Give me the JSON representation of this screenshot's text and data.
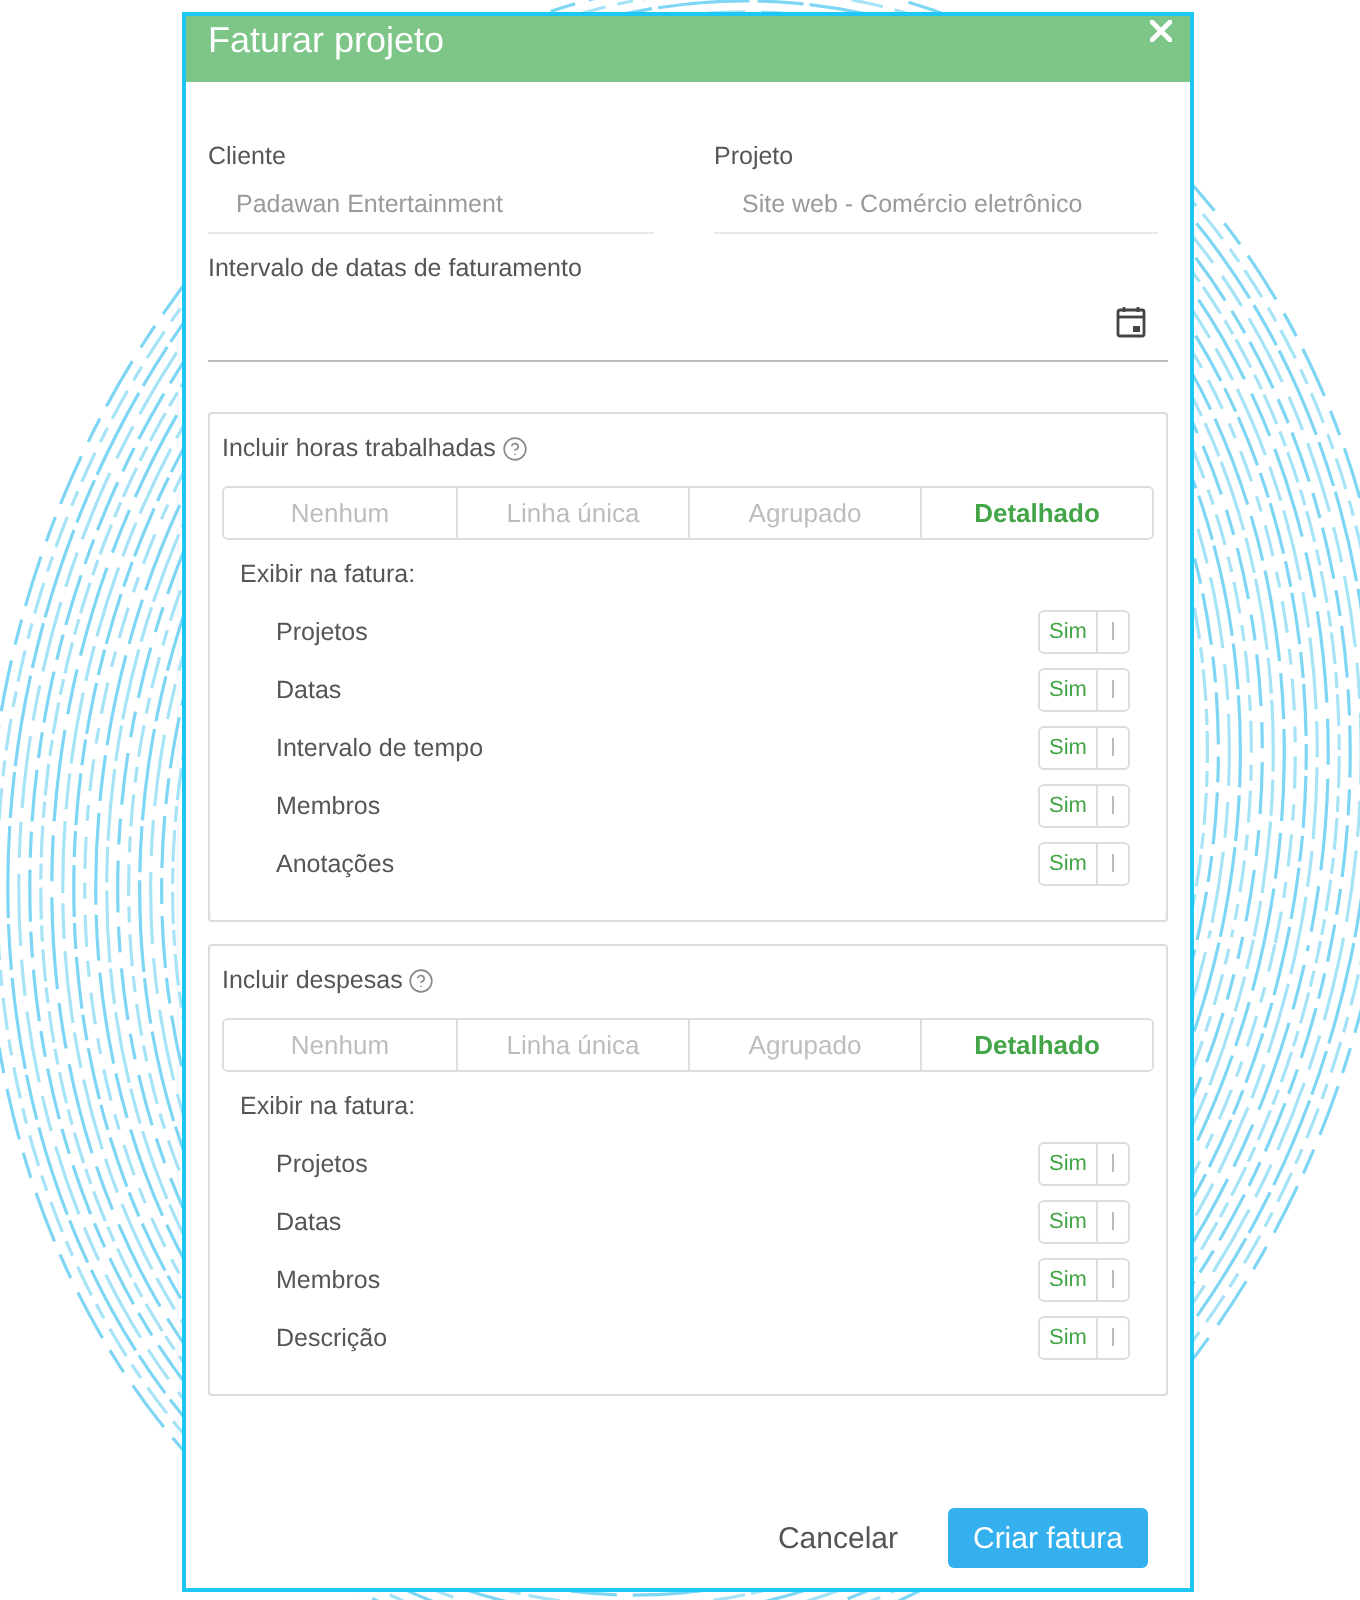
{
  "dialog": {
    "title": "Faturar projeto"
  },
  "fields": [
    {
      "label": "Cliente",
      "value": "Padawan Entertainment",
      "disabled": true
    },
    {
      "label": "Projeto",
      "value": "Site web - Comércio eletrônico",
      "disabled": true
    }
  ],
  "date_range": {
    "label": "Intervalo de datas de faturamento"
  },
  "sections": [
    {
      "title": "Incluir horas trabalhadas",
      "options": [
        {
          "label": "Nenhum",
          "selected": false
        },
        {
          "label": "Linha única",
          "selected": false
        },
        {
          "label": "Agrupado",
          "selected": false
        },
        {
          "label": "Detalhado",
          "selected": true
        }
      ],
      "show_label": "Exibir na fatura:",
      "toggles": [
        {
          "label": "Projetos",
          "switch_label": "Sim",
          "on": true
        },
        {
          "label": "Datas",
          "switch_label": "Sim",
          "on": true
        },
        {
          "label": "Intervalo de tempo",
          "switch_label": "Sim",
          "on": true
        },
        {
          "label": "Membros",
          "switch_label": "Sim",
          "on": true
        },
        {
          "label": "Anotações",
          "switch_label": "Sim",
          "on": true
        }
      ]
    },
    {
      "title": "Incluir despesas",
      "options": [
        {
          "label": "Nenhum",
          "selected": false
        },
        {
          "label": "Linha única",
          "selected": false
        },
        {
          "label": "Agrupado",
          "selected": false
        },
        {
          "label": "Detalhado",
          "selected": true
        }
      ],
      "show_label": "Exibir na fatura:",
      "toggles": [
        {
          "label": "Projetos",
          "switch_label": "Sim",
          "on": true
        },
        {
          "label": "Datas",
          "switch_label": "Sim",
          "on": true
        },
        {
          "label": "Membros",
          "switch_label": "Sim",
          "on": true
        },
        {
          "label": "Descrição",
          "switch_label": "Sim",
          "on": true
        }
      ]
    }
  ],
  "footer": {
    "cancel": "Cancelar",
    "submit": "Criar fatura"
  }
}
